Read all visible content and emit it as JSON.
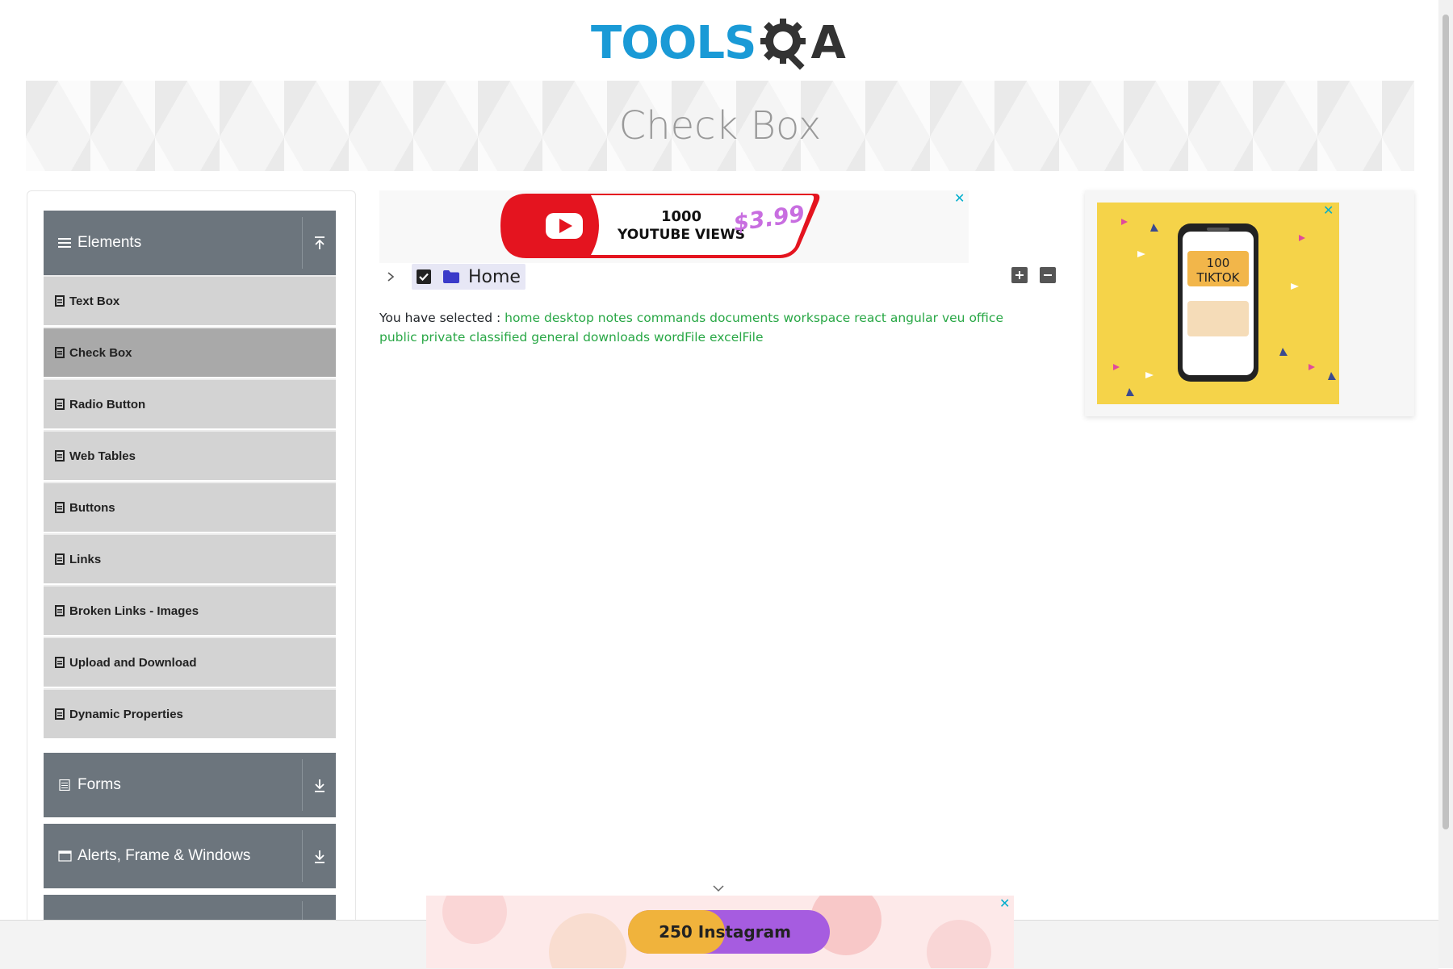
{
  "header": {
    "logo_text_left": "TOOLS",
    "logo_text_right": "A",
    "page_title": "Check Box"
  },
  "sidebar": {
    "groups": [
      {
        "label": "Elements",
        "expanded": true
      },
      {
        "label": "Forms",
        "expanded": false
      },
      {
        "label": "Alerts, Frame & Windows",
        "expanded": false
      }
    ],
    "items": [
      {
        "label": "Text Box"
      },
      {
        "label": "Check Box",
        "active": true
      },
      {
        "label": "Radio Button"
      },
      {
        "label": "Web Tables"
      },
      {
        "label": "Buttons"
      },
      {
        "label": "Links"
      },
      {
        "label": "Broken Links - Images"
      },
      {
        "label": "Upload and Download"
      },
      {
        "label": "Dynamic Properties"
      }
    ]
  },
  "tree": {
    "root_label": "Home",
    "checked": true,
    "expand_all_icon": "plus-square-icon",
    "collapse_all_icon": "minus-square-icon"
  },
  "result": {
    "prefix": "You have selected :",
    "selected": [
      "home",
      "desktop",
      "notes",
      "commands",
      "documents",
      "workspace",
      "react",
      "angular",
      "veu",
      "office",
      "public",
      "private",
      "classified",
      "general",
      "downloads",
      "wordFile",
      "excelFile"
    ]
  },
  "ads": {
    "top": {
      "line1": "1000",
      "line2": "YOUTUBE VIEWS",
      "price": "$3.99"
    },
    "right": {
      "line1": "100",
      "line2": "TIKTOK"
    },
    "bottom": {
      "text": "250 Instagram"
    },
    "close_glyph": "✕"
  },
  "colors": {
    "accent": "#1a9ad6",
    "sidebar_group": "#6c757d",
    "sidebar_item": "#d3d3d3",
    "sidebar_active": "#a9a9a9",
    "selected_text": "#28a745"
  }
}
